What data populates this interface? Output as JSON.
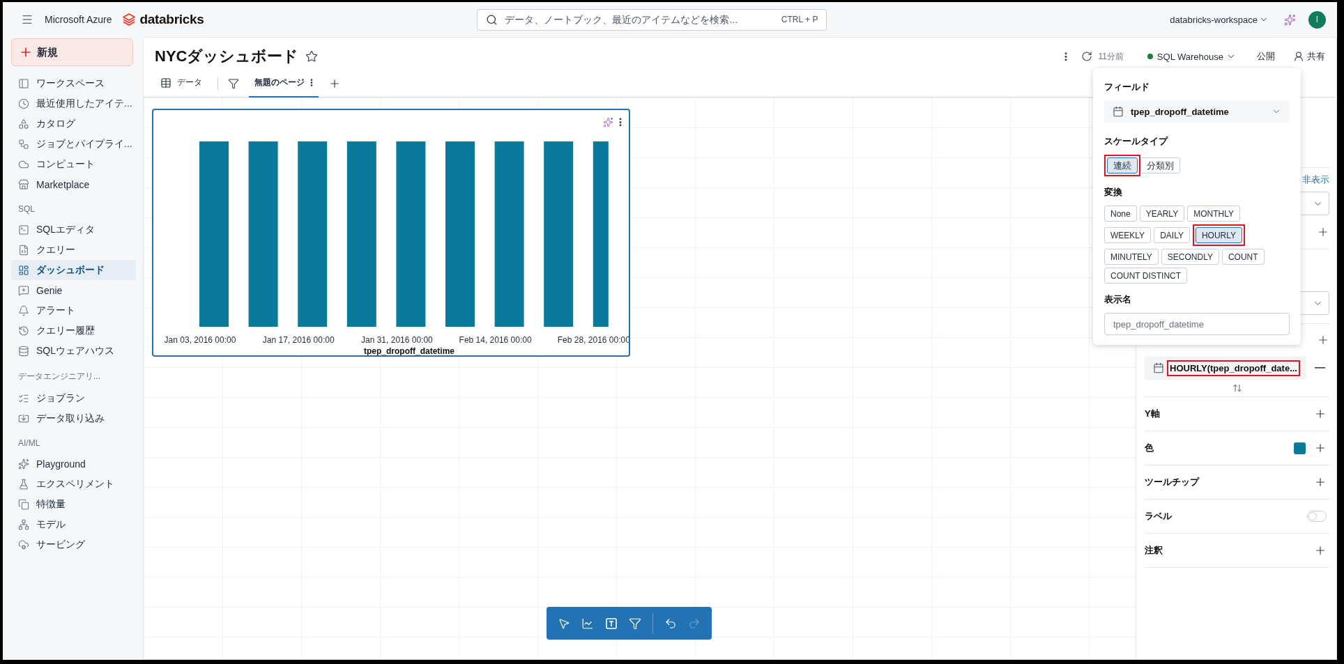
{
  "topbar": {
    "brand": "Microsoft Azure",
    "product": "databricks",
    "search": {
      "placeholder": "データ、ノートブック、最近のアイテムなどを検索...",
      "shortcut": "CTRL + P"
    },
    "workspace": "databricks-workspace",
    "avatar": "I"
  },
  "sidebar": {
    "new_button": "新規",
    "sections": [
      {
        "items": [
          {
            "label": "ワークスペース",
            "selected": false
          },
          {
            "label": "最近使用したアイテ...",
            "selected": false
          },
          {
            "label": "カタログ",
            "selected": false
          },
          {
            "label": "ジョブとパイプライ...",
            "selected": false
          },
          {
            "label": "コンピュート",
            "selected": false
          },
          {
            "label": "Marketplace",
            "selected": false
          }
        ]
      },
      {
        "title": "SQL",
        "items": [
          {
            "label": "SQLエディタ",
            "selected": false
          },
          {
            "label": "クエリー",
            "selected": false
          },
          {
            "label": "ダッシュボード",
            "selected": true
          },
          {
            "label": "Genie",
            "selected": false
          },
          {
            "label": "アラート",
            "selected": false
          },
          {
            "label": "クエリー履歴",
            "selected": false
          },
          {
            "label": "SQLウェアハウス",
            "selected": false
          }
        ]
      },
      {
        "title": "データエンジニアリ...",
        "items": [
          {
            "label": "ジョブラン",
            "selected": false
          },
          {
            "label": "データ取り込み",
            "selected": false
          }
        ]
      },
      {
        "title": "AI/ML",
        "items": [
          {
            "label": "Playground",
            "selected": false
          },
          {
            "label": "エクスペリメント",
            "selected": false
          },
          {
            "label": "特徴量",
            "selected": false
          },
          {
            "label": "モデル",
            "selected": false
          },
          {
            "label": "サービング",
            "selected": false
          }
        ]
      }
    ]
  },
  "header": {
    "title": "NYCダッシュボード",
    "updated": "11分前",
    "warehouse": {
      "name": "SQL Warehouse",
      "running": true
    },
    "publish": "公開",
    "share": "共有"
  },
  "tabs": {
    "data_tab": "データ",
    "pages": [
      {
        "label": "無題のページ",
        "selected": true
      }
    ]
  },
  "chart": {
    "x_tick_labels": [
      "Jan 03, 2016 00:00",
      "Jan 17, 2016 00:00",
      "Jan 31, 2016 00:00",
      "Feb 14, 2016 00:00",
      "Feb 28, 2016 00:00"
    ],
    "xlabel": "tpep_dropoff_datetime"
  },
  "popup": {
    "field_label": "フィールド",
    "field": "tpep_dropoff_datetime",
    "scale_label": "スケールタイプ",
    "scale_types": [
      {
        "label": "連続",
        "selected": true,
        "highlighted": true
      },
      {
        "label": "分類別",
        "selected": false,
        "highlighted": false
      }
    ],
    "transform_label": "変換",
    "transforms": [
      {
        "label": "None",
        "selected": false,
        "highlighted": false
      },
      {
        "label": "YEARLY",
        "selected": false,
        "highlighted": false
      },
      {
        "label": "MONTHLY",
        "selected": false,
        "highlighted": false
      },
      {
        "label": "WEEKLY",
        "selected": false,
        "highlighted": false
      },
      {
        "label": "DAILY",
        "selected": false,
        "highlighted": false
      },
      {
        "label": "HOURLY",
        "selected": true,
        "highlighted": true
      },
      {
        "label": "MINUTELY",
        "selected": false,
        "highlighted": false
      },
      {
        "label": "SECONDLY",
        "selected": false,
        "highlighted": false
      },
      {
        "label": "COUNT",
        "selected": false,
        "highlighted": false
      },
      {
        "label": "COUNT DISTINCT",
        "selected": false,
        "highlighted": false
      }
    ],
    "display_name_label": "表示名",
    "display_name": {
      "placeholder": "tpep_dropoff_datetime"
    }
  },
  "panel": {
    "hide_link": "非表示",
    "x_field": {
      "label": "HOURLY(tpep_dropoff_date...",
      "highlighted": true
    },
    "sections": [
      {
        "label": "Y軸",
        "kind": "add"
      },
      {
        "label": "色",
        "kind": "color",
        "color": "#0a7a9c"
      },
      {
        "label": "ツールチップ",
        "kind": "add"
      },
      {
        "label": "ラベル",
        "kind": "toggle",
        "on": false
      },
      {
        "label": "注釈",
        "kind": "add"
      }
    ]
  }
}
